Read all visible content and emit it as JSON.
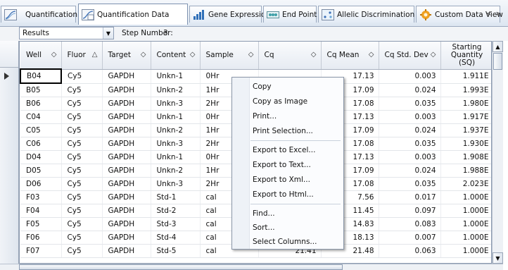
{
  "tabs": [
    {
      "label": "Quantification",
      "icon": "amplification-curve-icon"
    },
    {
      "label": "Quantification Data",
      "icon": "quantification-data-icon",
      "active": true
    },
    {
      "label": "Gene Expression",
      "icon": "bar-chart-icon"
    },
    {
      "label": "End Point",
      "icon": "end-point-icon"
    },
    {
      "label": "Allelic Discrimination",
      "icon": "allelic-discrimination-icon"
    },
    {
      "label": "Custom Data View",
      "icon": "custom-data-view-icon"
    }
  ],
  "tab_nav": {
    "prev": "<",
    "next": ">"
  },
  "toolbar": {
    "results_value": "Results",
    "step_label": "Step Number:",
    "step_value": "3"
  },
  "table": {
    "columns": [
      {
        "label": "Well",
        "sort": "◇"
      },
      {
        "label": "Fluor",
        "sort": "△"
      },
      {
        "label": "Target",
        "sort": "◇"
      },
      {
        "label": "Content",
        "sort": "◇"
      },
      {
        "label": "Sample",
        "sort": "◇"
      },
      {
        "label": "Cq",
        "sort": "◇"
      },
      {
        "label": "Cq Mean",
        "sort": "◇"
      },
      {
        "label": "Cq Std. Dev",
        "sort": "◇"
      },
      {
        "label": "Starting Quantity (SQ)",
        "sort": ""
      }
    ],
    "rows": [
      [
        "B04",
        "Cy5",
        "GAPDH",
        "Unkn-1",
        "0Hr",
        "",
        "17.13",
        "0.003",
        "1.911E"
      ],
      [
        "B05",
        "Cy5",
        "GAPDH",
        "Unkn-2",
        "1Hr",
        "",
        "17.09",
        "0.024",
        "1.993E"
      ],
      [
        "B06",
        "Cy5",
        "GAPDH",
        "Unkn-3",
        "2Hr",
        "",
        "17.08",
        "0.035",
        "1.980E"
      ],
      [
        "C04",
        "Cy5",
        "GAPDH",
        "Unkn-1",
        "0Hr",
        "",
        "17.13",
        "0.003",
        "1.917E"
      ],
      [
        "C05",
        "Cy5",
        "GAPDH",
        "Unkn-2",
        "1Hr",
        "",
        "17.09",
        "0.024",
        "1.937E"
      ],
      [
        "C06",
        "Cy5",
        "GAPDH",
        "Unkn-3",
        "2Hr",
        "",
        "17.08",
        "0.035",
        "1.930E"
      ],
      [
        "D04",
        "Cy5",
        "GAPDH",
        "Unkn-1",
        "0Hr",
        "",
        "17.13",
        "0.003",
        "1.908E"
      ],
      [
        "D05",
        "Cy5",
        "GAPDH",
        "Unkn-2",
        "1Hr",
        "",
        "17.09",
        "0.024",
        "1.988E"
      ],
      [
        "D06",
        "Cy5",
        "GAPDH",
        "Unkn-3",
        "2Hr",
        "",
        "17.08",
        "0.035",
        "2.023E"
      ],
      [
        "F03",
        "Cy5",
        "GAPDH",
        "Std-1",
        "cal",
        "",
        "7.56",
        "0.017",
        "1.000E"
      ],
      [
        "F04",
        "Cy5",
        "GAPDH",
        "Std-2",
        "cal",
        "",
        "11.45",
        "0.097",
        "1.000E"
      ],
      [
        "F05",
        "Cy5",
        "GAPDH",
        "Std-3",
        "cal",
        "",
        "14.83",
        "0.083",
        "1.000E"
      ],
      [
        "F06",
        "Cy5",
        "GAPDH",
        "Std-4",
        "cal",
        "",
        "18.13",
        "0.007",
        "1.000E"
      ],
      [
        "F07",
        "Cy5",
        "GAPDH",
        "Std-5",
        "cal",
        "21.41",
        "21.48",
        "0.063",
        "1.000E"
      ]
    ]
  },
  "context_menu": {
    "items": [
      "Copy",
      "Copy as Image",
      "Print...",
      "Print Selection...",
      "Export to Excel...",
      "Export to Text...",
      "Export to Xml...",
      "Export to Html...",
      "Find...",
      "Sort...",
      "Select Columns..."
    ]
  },
  "colors": {
    "accent": "#7e92b0",
    "selection_border": "#000000",
    "header_bg": "#e6ebf2"
  }
}
